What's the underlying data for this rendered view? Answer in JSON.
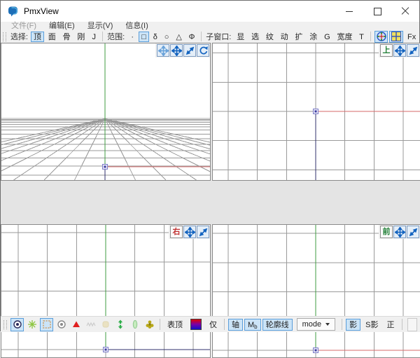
{
  "window": {
    "title": "PmxView"
  },
  "menu": {
    "items": [
      {
        "name": "file",
        "label": "文件(F)",
        "disabled": true
      },
      {
        "name": "edit",
        "label": "编辑(E)",
        "disabled": false
      },
      {
        "name": "view",
        "label": "显示(V)",
        "disabled": false
      },
      {
        "name": "info",
        "label": "信息(I)",
        "disabled": false
      }
    ]
  },
  "toolbar": {
    "groups": [
      {
        "name": "select",
        "label": "选择:",
        "buttons": [
          {
            "name": "select-vertex",
            "label": "顶",
            "selected": true
          },
          {
            "name": "select-face",
            "label": "面",
            "selected": false
          },
          {
            "name": "select-bone",
            "label": "骨",
            "selected": false
          },
          {
            "name": "select-rigid",
            "label": "刚",
            "selected": false
          },
          {
            "name": "select-joint",
            "label": "J",
            "selected": false
          }
        ]
      },
      {
        "name": "range",
        "label": "范围:",
        "buttons": [
          {
            "name": "range-point",
            "label": "·",
            "selected": false
          },
          {
            "name": "range-box",
            "label": "□",
            "selected": true
          },
          {
            "name": "range-delta",
            "label": "δ",
            "selected": false
          },
          {
            "name": "range-circle",
            "label": "○",
            "selected": false
          },
          {
            "name": "range-triangle",
            "label": "△",
            "selected": false
          },
          {
            "name": "range-phi",
            "label": "Φ",
            "selected": false
          }
        ]
      },
      {
        "name": "subwindow",
        "label": "子窗口:",
        "buttons": [
          {
            "name": "sub-display",
            "label": "显",
            "selected": false
          },
          {
            "name": "sub-select",
            "label": "选",
            "selected": false
          },
          {
            "name": "sub-texture",
            "label": "纹",
            "selected": false
          },
          {
            "name": "sub-motion",
            "label": "动",
            "selected": false
          },
          {
            "name": "sub-extend",
            "label": "扩",
            "selected": false
          },
          {
            "name": "sub-paint",
            "label": "涂",
            "selected": false
          },
          {
            "name": "sub-g",
            "label": "G",
            "selected": false
          },
          {
            "name": "sub-width",
            "label": "宽度",
            "selected": false
          },
          {
            "name": "sub-t",
            "label": "T",
            "selected": false
          }
        ]
      }
    ],
    "icon_toggles": [
      {
        "name": "axis-gizmo-toggle",
        "icon": "axis-target-icon",
        "selected": true
      },
      {
        "name": "quad-view-toggle",
        "icon": "quad-grid-icon",
        "selected": true
      }
    ],
    "fx_label": "Fx"
  },
  "viewports": {
    "perspective": {
      "name": "perspective",
      "buttons": [
        {
          "name": "orbit-button",
          "icon": "orbit-icon"
        },
        {
          "name": "pan-button",
          "icon": "pan-icon"
        },
        {
          "name": "zoom-button",
          "icon": "zoom-icon"
        },
        {
          "name": "rotate-button",
          "icon": "rotate-icon"
        }
      ]
    },
    "top": {
      "label": "上",
      "label_color": "#1e7e34",
      "buttons": [
        {
          "name": "pan-button",
          "icon": "pan-icon"
        },
        {
          "name": "zoom-button",
          "icon": "zoom-icon"
        }
      ]
    },
    "right": {
      "label": "右",
      "label_color": "#c03030",
      "buttons": [
        {
          "name": "pan-button",
          "icon": "pan-icon"
        },
        {
          "name": "zoom-button",
          "icon": "zoom-icon"
        }
      ]
    },
    "front": {
      "label": "前",
      "label_color": "#1e7e34",
      "buttons": [
        {
          "name": "pan-button",
          "icon": "pan-icon"
        },
        {
          "name": "zoom-button",
          "icon": "zoom-icon"
        }
      ]
    }
  },
  "colors": {
    "grid": "#9a9a9a",
    "horizon": "#b4b4b4",
    "axis_x_red": "#d46a6a",
    "axis_y_green": "#3f9b41",
    "axis_z_navy": "#30306e",
    "handle_border": "#7d7dc8",
    "handle_fill": "#ebebf8",
    "handle_core": "#3a3aa0",
    "selected_bg": "#cce4f7",
    "selected_border": "#5a9edb"
  },
  "bottombar": {
    "icons": [
      {
        "name": "vertex-display-toggle",
        "icon": "radio-dark-icon",
        "selected": true,
        "disabled": false
      },
      {
        "name": "wire-star-toggle",
        "icon": "star-icon",
        "selected": false,
        "disabled": false
      },
      {
        "name": "dotted-square-toggle",
        "icon": "dotted-square-icon",
        "selected": true,
        "disabled": false
      },
      {
        "name": "radio-grey-toggle",
        "icon": "radio-grey-icon",
        "selected": false,
        "disabled": false
      },
      {
        "name": "red-triangle-toggle",
        "icon": "triangle-icon",
        "selected": false,
        "disabled": false
      },
      {
        "name": "wave-toggle",
        "icon": "waves-icon",
        "selected": false,
        "disabled": true
      },
      {
        "name": "blob-toggle",
        "icon": "blob-icon",
        "selected": false,
        "disabled": true
      },
      {
        "name": "updown-arrows-toggle",
        "icon": "updown-icon",
        "selected": false,
        "disabled": false
      },
      {
        "name": "capsule-toggle",
        "icon": "capsule-icon",
        "selected": false,
        "disabled": false
      },
      {
        "name": "flower-toggle",
        "icon": "flower-icon",
        "selected": false,
        "disabled": false
      }
    ],
    "mid_buttons": [
      {
        "name": "vertex-top-button",
        "label": "表顶"
      },
      {
        "name": "color-swatch",
        "swatch": true
      },
      {
        "name": "only-button",
        "label": "仅"
      }
    ],
    "toggles": [
      {
        "name": "axis-toggle",
        "label": "轴",
        "selected": true
      },
      {
        "name": "mb-toggle",
        "label_main": "M",
        "label_sub": "b",
        "selected": true
      },
      {
        "name": "outline-toggle",
        "label": "轮廓线",
        "selected": true
      }
    ],
    "mode": {
      "label": "mode"
    },
    "render_toggles": [
      {
        "name": "shadow-toggle",
        "label": "影",
        "selected": true
      },
      {
        "name": "self-shadow-toggle",
        "label": "S影",
        "selected": false
      },
      {
        "name": "front-face-toggle",
        "label": "正",
        "selected": false
      }
    ]
  }
}
